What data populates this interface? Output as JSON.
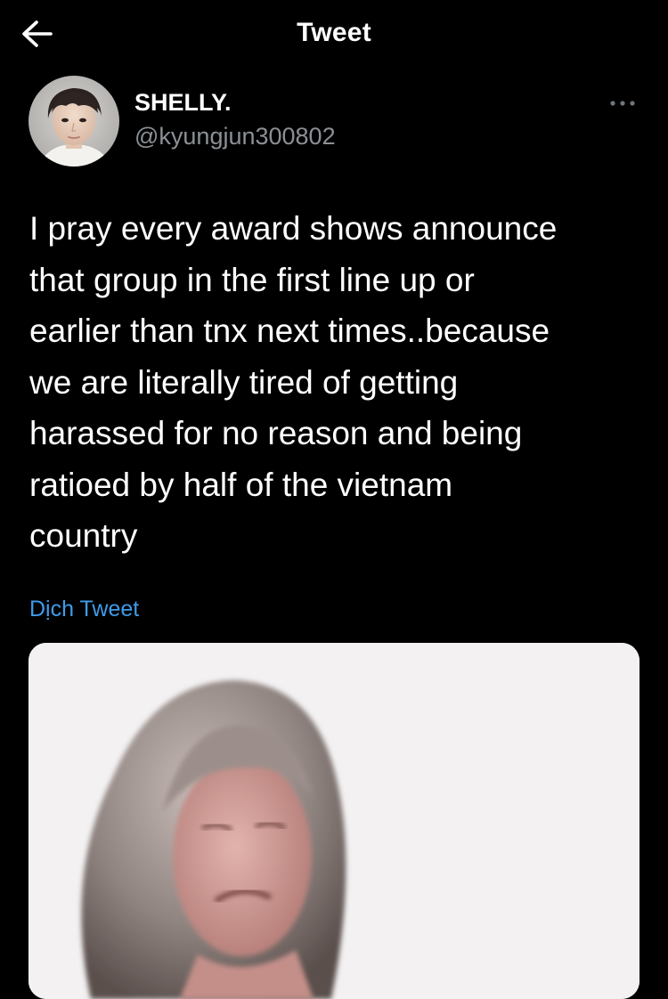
{
  "header": {
    "title": "Tweet",
    "back_icon": "arrow-left-icon"
  },
  "author": {
    "display_name": "SHELLY.",
    "handle": "@kyungjun300802",
    "avatar_icon": "avatar"
  },
  "more_icon": "more-horizontal-icon",
  "tweet": {
    "text": "I pray every award shows announce\nthat group in the first line up or\nearlier than tnx next times..because\nwe are literally tired of getting\nharassed for no reason and being\nratioed by half of the vietnam\ncountry",
    "translate_label": "Dịch Tweet"
  },
  "media": {
    "kind": "image",
    "background_color": "#f3f1f2"
  },
  "colors": {
    "background": "#000000",
    "text": "#ffffff",
    "secondary_text": "#8b9096",
    "link": "#3f9be8"
  }
}
